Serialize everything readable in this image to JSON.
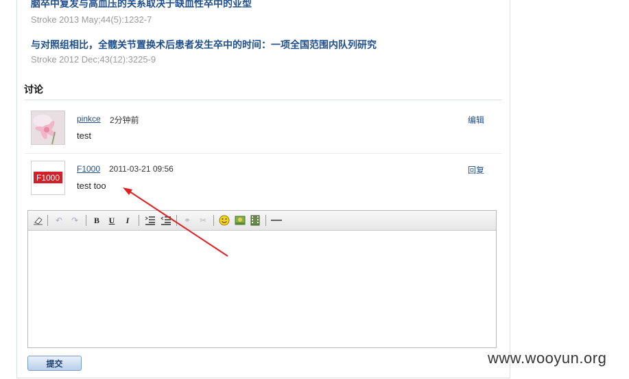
{
  "articles": [
    {
      "title": "脑卒中复发与高血压的关系取决于缺血性卒中的亚型",
      "meta": "Stroke 2013 May;44(5):1232-7"
    },
    {
      "title": "与对照组相比，全髋关节置换术后患者发生卒中的时间：一项全国范围内队列研究",
      "meta": "Stroke 2012 Dec;43(12):3225-9"
    }
  ],
  "discussion": {
    "title": "讨论",
    "comments": [
      {
        "user": "pinkce",
        "time": "2分钟前",
        "text": "test",
        "action": "编辑"
      },
      {
        "user": "F1000",
        "time": "2011-03-21 09:56",
        "text": "test too",
        "action": "回复"
      }
    ],
    "f1000_logo_text": "F1000"
  },
  "toolbar": {
    "tools": [
      "eraser-icon",
      "undo-icon",
      "redo-icon",
      "bold-icon",
      "underline-icon",
      "italic-icon",
      "ordered-list-icon",
      "unordered-list-icon",
      "link-icon",
      "unlink-icon",
      "smiley-icon",
      "image-icon",
      "video-icon",
      "horizontal-rule-icon"
    ],
    "bold": "B",
    "underline": "U",
    "italic": "I"
  },
  "submit_label": "提交",
  "watermark": "www.wooyun.org",
  "colors": {
    "link": "#1f4e8c",
    "arrow": "#e02020",
    "meta": "#9a9a9a"
  }
}
